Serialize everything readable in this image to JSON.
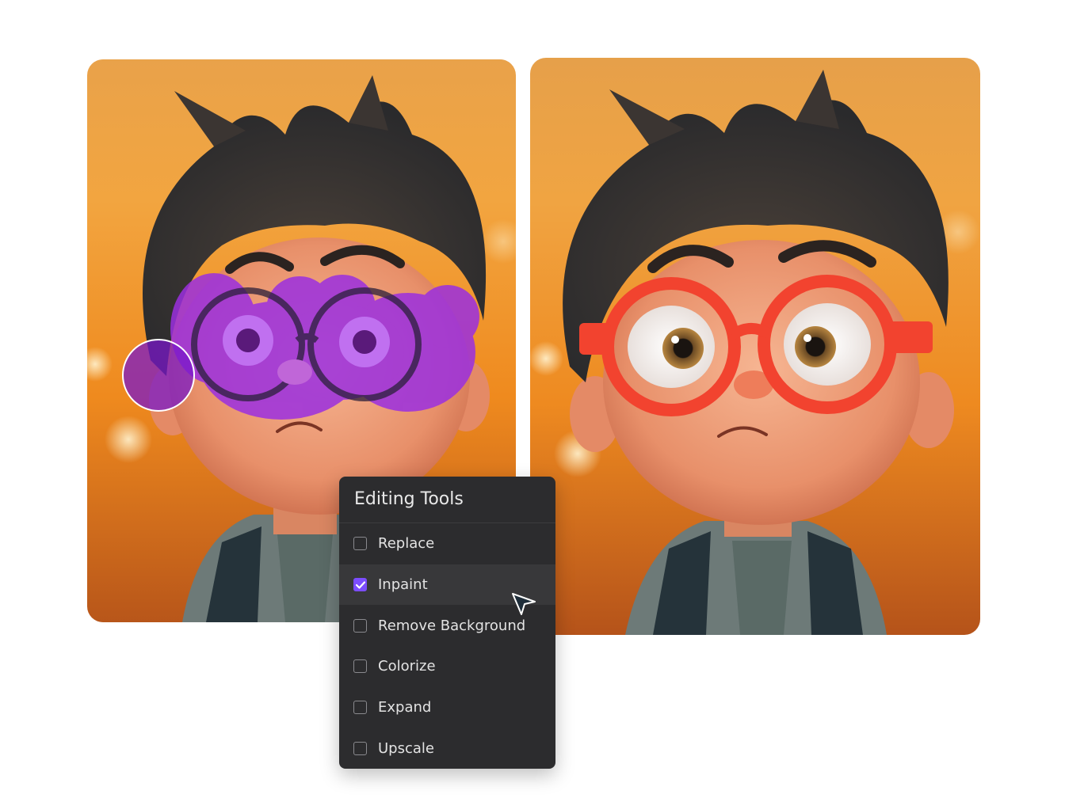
{
  "panel": {
    "title": "Editing Tools",
    "tools": [
      {
        "label": "Replace",
        "checked": false
      },
      {
        "label": "Inpaint",
        "checked": true
      },
      {
        "label": "Remove Background",
        "checked": false
      },
      {
        "label": "Colorize",
        "checked": false
      },
      {
        "label": "Expand",
        "checked": false
      },
      {
        "label": "Upscale",
        "checked": false
      }
    ]
  },
  "images": {
    "before": {
      "icon": "boy-portrait-with-inpaint-mask"
    },
    "after": {
      "icon": "boy-portrait-with-red-glasses"
    }
  },
  "brush": {
    "icon": "brush-cursor-circle"
  },
  "pointer": {
    "icon": "arrow-pointer-icon"
  },
  "colors": {
    "accent": "#7c4dff",
    "mask": "#9b2fe0",
    "glasses": "#f2432f",
    "background_orange": "#f08a1c",
    "panel_bg": "#2c2c2e"
  }
}
